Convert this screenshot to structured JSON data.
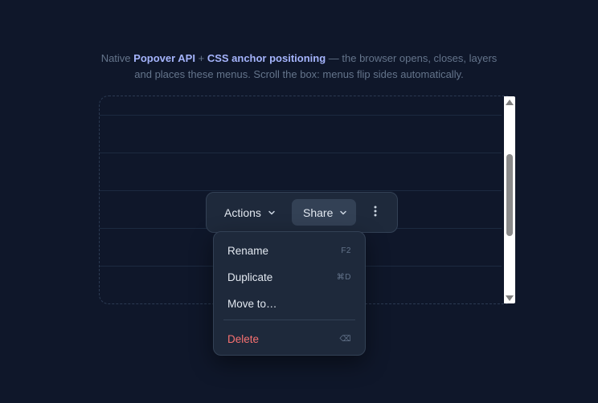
{
  "intro": {
    "prefix": "Native ",
    "strong1": "Popover API",
    "plus": " + ",
    "strong2": "CSS anchor positioning",
    "rest": " — the browser opens, closes, layers and places these menus. Scroll the box: menus flip sides automatically."
  },
  "toolbar": {
    "actions_label": "Actions",
    "share_label": "Share",
    "more_icon": "⋮"
  },
  "menu": {
    "items": [
      {
        "label": "Rename",
        "shortcut": "F2"
      },
      {
        "label": "Duplicate",
        "shortcut": "⌘D"
      },
      {
        "label": "Move to…",
        "shortcut": ""
      },
      {
        "label": "Delete",
        "shortcut": "⌫"
      }
    ]
  },
  "icons": {
    "chevron": "chevron-down-icon",
    "more": "more-vertical-icon",
    "scroll_up": "scroll-up-arrow-icon",
    "scroll_down": "scroll-down-arrow-icon"
  },
  "colors": {
    "background": "#0f172a",
    "panel": "#1e293b",
    "accent_text": "#a5b4fc",
    "danger": "#f87171",
    "muted": "#64748b"
  }
}
